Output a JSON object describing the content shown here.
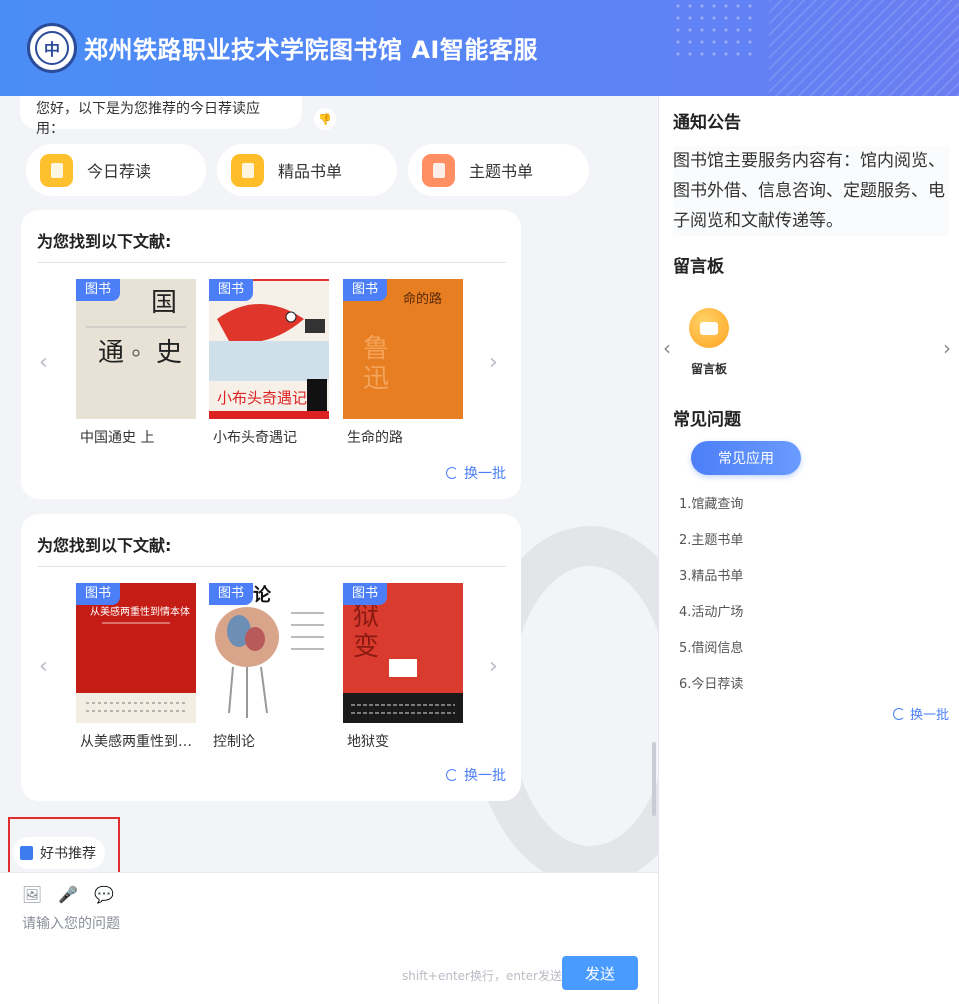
{
  "header": {
    "title": "郑州铁路职业技术学院图书馆 AI智能客服",
    "logo_text": "中"
  },
  "chat": {
    "greeting": "您好，以下是为您推荐的今日荐读应用：",
    "quick_actions": [
      "今日荐读",
      "精品书单",
      "主题书单"
    ],
    "cards": [
      {
        "title": "为您找到以下文献:",
        "tag": "图书",
        "books": [
          "中国通史 上",
          "小布头奇遇记",
          "生命的路"
        ],
        "refresh": "换一批"
      },
      {
        "title": "为您找到以下文献:",
        "tag": "图书",
        "books": [
          "从美感两重性到情本体",
          "控制论",
          "地狱变"
        ],
        "refresh": "换一批"
      }
    ],
    "recommend_pill": "好书推荐"
  },
  "input": {
    "placeholder": "请输入您的问题",
    "hint": "shift+enter换行，enter发送",
    "send": "发送"
  },
  "sidebar": {
    "notice_title": "通知公告",
    "notice_text": "图书馆主要服务内容有：馆内阅览、图书外借、信息咨询、定题服务、电子阅览和文献传递等。",
    "board_title": "留言板",
    "board_item": "留言板",
    "faq_title": "常见问题",
    "faq_button": "常见应用",
    "faq_items": [
      "1.馆藏查询",
      "2.主题书单",
      "3.精品书单",
      "4.活动广场",
      "5.借阅信息",
      "6.今日荐读"
    ],
    "refresh": "换一批"
  },
  "colors": {
    "accent": "#4c7ff7",
    "header_start": "#4a8df5",
    "header_end": "#6a7ef2",
    "highlight_border": "#e12d2d"
  }
}
